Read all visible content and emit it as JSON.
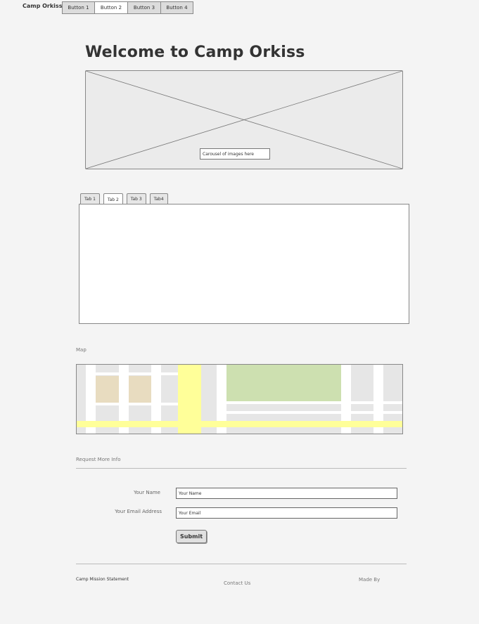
{
  "header": {
    "brand": "Camp Orkiss",
    "nav": [
      {
        "label": "Button 1",
        "active": false
      },
      {
        "label": "Button 2",
        "active": true
      },
      {
        "label": "Button 3",
        "active": false
      },
      {
        "label": "Button 4",
        "active": false
      }
    ]
  },
  "main": {
    "title": "Welcome to Camp Orkiss",
    "carousel": {
      "label": "Carousel of images here"
    },
    "tabs": [
      {
        "label": "Tab 1",
        "active": false
      },
      {
        "label": "Tab 2",
        "active": true
      },
      {
        "label": "Tab 3",
        "active": false
      },
      {
        "label": "Tab4",
        "active": false
      }
    ],
    "map_label": "Map"
  },
  "form": {
    "heading": "Request More Info",
    "name_label": "Your Name",
    "name_value": "Your Name",
    "email_label": "Your Email Address",
    "email_value": "Your Email",
    "submit_label": "Submit"
  },
  "footer": {
    "mission": "Camp Mission Statement",
    "contact": "Contact Us",
    "made_by": "Made By"
  },
  "colors": {
    "background": "#f4f4f4",
    "map_road": "#ffffff",
    "map_highway": "#ffff99",
    "map_park": "#cde0b0",
    "map_building": "#e8dcc0"
  }
}
